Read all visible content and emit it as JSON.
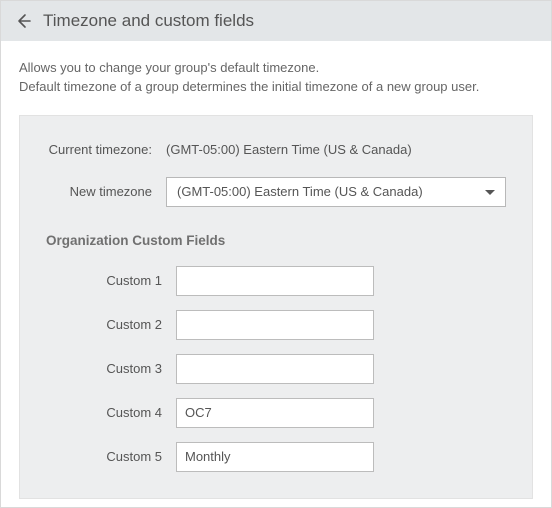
{
  "header": {
    "title": "Timezone and custom fields"
  },
  "description": {
    "line1": "Allows you to change your group's default timezone.",
    "line2": "Default timezone of a group determines the initial timezone of a new group user."
  },
  "timezone": {
    "current_label": "Current timezone:",
    "current_value": "(GMT-05:00) Eastern Time (US & Canada)",
    "new_label": "New timezone",
    "new_value": "(GMT-05:00) Eastern Time (US & Canada)"
  },
  "custom_fields": {
    "heading": "Organization Custom Fields",
    "fields": [
      {
        "label": "Custom 1",
        "value": ""
      },
      {
        "label": "Custom 2",
        "value": ""
      },
      {
        "label": "Custom 3",
        "value": ""
      },
      {
        "label": "Custom 4",
        "value": "OC7"
      },
      {
        "label": "Custom 5",
        "value": "Monthly"
      }
    ]
  }
}
